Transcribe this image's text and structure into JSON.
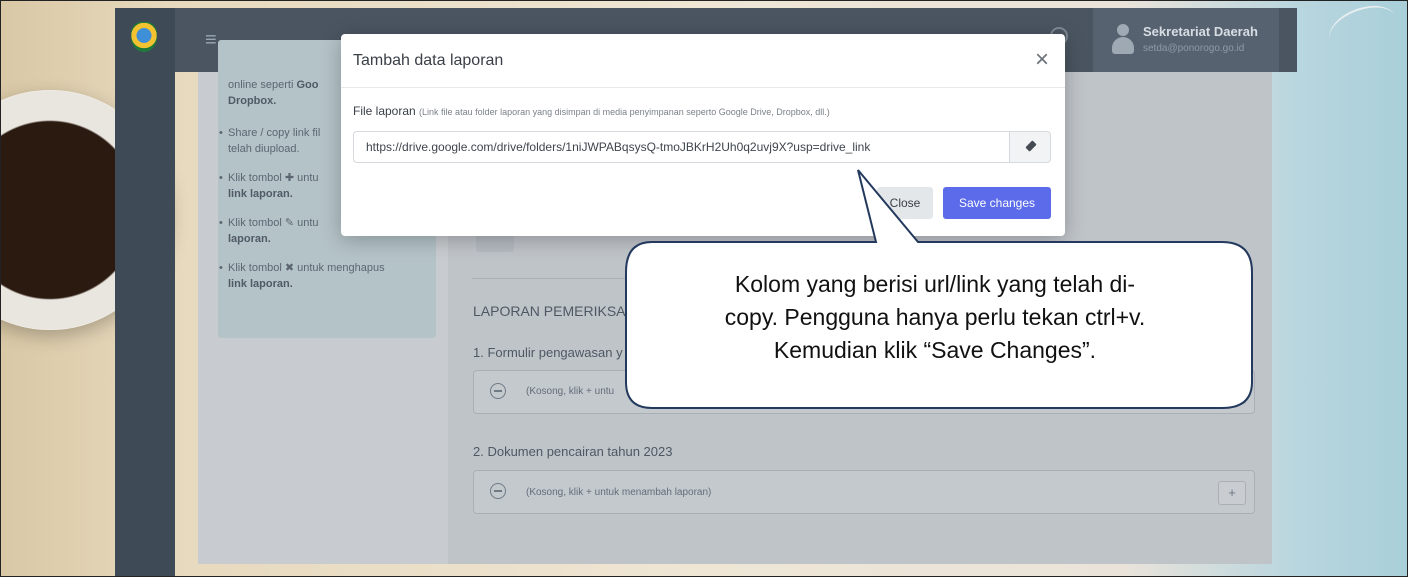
{
  "header": {
    "user_name": "Sekretariat Daerah",
    "user_email": "setda@ponorogo.go.id"
  },
  "help": {
    "line1": "online seperti",
    "line1_bold": "Goo",
    "line2_bold": "Dropbox.",
    "bullet2_l1": "Share / copy link fil",
    "bullet2_l2": "telah diupload.",
    "bullet3_l1": "Klik tombol ✚ untu",
    "bullet3_l2_bold": "link laporan.",
    "bullet4_l1": "Klik tombol ✎ untu",
    "bullet4_l2_bold": "laporan.",
    "bullet5_l1": "Klik tombol ✖ untuk menghapus",
    "bullet5_l2_bold": "link laporan."
  },
  "main": {
    "section_title": "LAPORAN PEMERIKSAA",
    "item1_label": "1. Formulir pengawasan y",
    "item1_slot_text": "(Kosong, klik + untu",
    "item2_label": "2. Dokumen pencairan tahun 2023",
    "item2_slot_text": "(Kosong, klik + untuk menambah laporan)",
    "plus_label": "+"
  },
  "modal": {
    "title": "Tambah data laporan",
    "close_symbol": "×",
    "file_label": "File laporan",
    "file_hint": "(Link file atau folder laporan yang disimpan di media penyimpanan seperto Google Drive, Dropbox, dll.)",
    "url_value": "https://drive.google.com/drive/folders/1niJWPABqsysQ-tmoJBKrH2Uh0q2uvj9X?usp=drive_link",
    "close_button": "Close",
    "save_button": "Save changes"
  },
  "callout": {
    "line1": "Kolom yang berisi url/link yang telah di-",
    "line2": "copy. Pengguna hanya perlu tekan ctrl+v.",
    "line3": "Kemudian klik “Save Changes”."
  },
  "colors": {
    "primary": "#5b6bea",
    "topbar": "#4a5561"
  },
  "icons": [
    "hamburger-icon",
    "search-icon",
    "user-avatar-icon",
    "close-icon",
    "eraser-icon",
    "minus-circle-icon",
    "plus-icon"
  ]
}
